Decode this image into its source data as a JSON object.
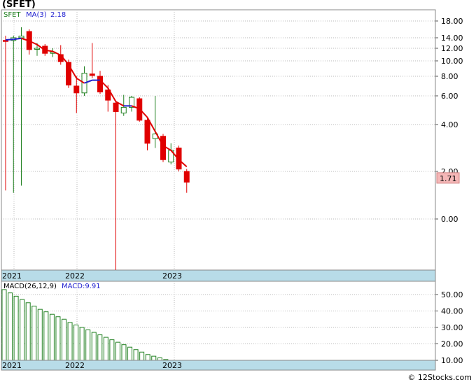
{
  "header": {
    "title": "(SFET)",
    "ticker": "SFET",
    "ma_label": "MA(3)",
    "ma_value": "2.18",
    "macd_label": "MACD(26,12,9)",
    "macd_value_label": "MACD:9.91"
  },
  "footer": {
    "credit": "© 12Stocks.com"
  },
  "chart_data": [
    {
      "type": "candlestick",
      "title": "(SFET)",
      "y_ticks": [
        0,
        2,
        4,
        6,
        8,
        10,
        12,
        14,
        18
      ],
      "y_tick_labels": [
        "0.00",
        "2.00",
        "4.00",
        "6.00",
        "8.00",
        "10.00",
        "12.00",
        "14.00",
        "18.00"
      ],
      "x_tick_labels": [
        "2021",
        "2022",
        "2023"
      ],
      "last_price": 1.71,
      "last_price_label": "1.71",
      "grid": true,
      "colors": {
        "up": "#208020",
        "down": "#e00000",
        "ma_down": "#e00000",
        "ma_up": "#2020d0",
        "axis_band": "#b8dce8",
        "price_tag_bg": "#f5b8b8"
      },
      "candles": [
        {
          "o": 13.5,
          "h": 14.5,
          "l": 1.2,
          "c": 13.4
        },
        {
          "o": 13.5,
          "h": 14.5,
          "l": 1.1,
          "c": 14.0
        },
        {
          "o": 14.0,
          "h": 16.5,
          "l": 1.4,
          "c": 14.4
        },
        {
          "o": 15.5,
          "h": 16.0,
          "l": 11.0,
          "c": 11.8
        },
        {
          "o": 12.0,
          "h": 13.0,
          "l": 10.8,
          "c": 12.0
        },
        {
          "o": 12.4,
          "h": 12.8,
          "l": 10.8,
          "c": 11.2
        },
        {
          "o": 11.2,
          "h": 12.0,
          "l": 10.6,
          "c": 11.4
        },
        {
          "o": 11.0,
          "h": 12.6,
          "l": 9.5,
          "c": 9.9
        },
        {
          "o": 9.8,
          "h": 10.2,
          "l": 6.8,
          "c": 7.1
        },
        {
          "o": 7.0,
          "h": 8.0,
          "l": 4.8,
          "c": 6.3
        },
        {
          "o": 6.3,
          "h": 9.3,
          "l": 6.0,
          "c": 8.4
        },
        {
          "o": 8.3,
          "h": 13.0,
          "l": 7.8,
          "c": 8.1
        },
        {
          "o": 8.0,
          "h": 8.7,
          "l": 6.2,
          "c": 6.4
        },
        {
          "o": 6.6,
          "h": 7.1,
          "l": 4.9,
          "c": 5.7
        },
        {
          "o": 5.5,
          "h": 5.6,
          "l": -4.3,
          "c": 4.9
        },
        {
          "o": 4.8,
          "h": 6.1,
          "l": 4.6,
          "c": 5.2
        },
        {
          "o": 5.2,
          "h": 6.0,
          "l": 4.9,
          "c": 5.9
        },
        {
          "o": 5.8,
          "h": 5.9,
          "l": 4.2,
          "c": 4.3
        },
        {
          "o": 4.3,
          "h": 4.5,
          "l": 2.9,
          "c": 3.2
        },
        {
          "o": 3.4,
          "h": 6.0,
          "l": 3.0,
          "c": 3.6
        },
        {
          "o": 3.5,
          "h": 3.6,
          "l": 2.4,
          "c": 2.5
        },
        {
          "o": 2.4,
          "h": 3.2,
          "l": 2.3,
          "c": 2.9
        },
        {
          "o": 3.0,
          "h": 3.1,
          "l": 2.0,
          "c": 2.1
        },
        {
          "o": 2.0,
          "h": 2.1,
          "l": 1.1,
          "c": 1.55
        }
      ],
      "ma": [
        13.6,
        13.7,
        13.9,
        13.4,
        12.7,
        11.7,
        11.5,
        10.9,
        9.5,
        7.8,
        7.3,
        7.6,
        7.6,
        6.8,
        5.6,
        5.3,
        5.3,
        5.1,
        4.5,
        3.7,
        3.1,
        2.9,
        2.5,
        2.2
      ]
    },
    {
      "type": "bar",
      "title": "MACD(26,12,9)",
      "y_ticks": [
        10,
        20,
        30,
        40,
        50
      ],
      "y_tick_labels": [
        "10.00",
        "20.00",
        "30.00",
        "40.00",
        "50.00"
      ],
      "x_tick_labels": [
        "2021",
        "2022",
        "2023"
      ],
      "values": [
        53,
        51,
        49,
        47,
        45,
        43,
        41,
        39.5,
        38,
        36.5,
        35,
        33,
        31.5,
        30,
        28.5,
        27,
        25.5,
        24,
        22.5,
        21,
        19.5,
        18,
        16.5,
        15,
        13.5,
        12.5,
        11.5,
        10.5,
        9.5,
        9.0,
        8.5
      ]
    }
  ]
}
